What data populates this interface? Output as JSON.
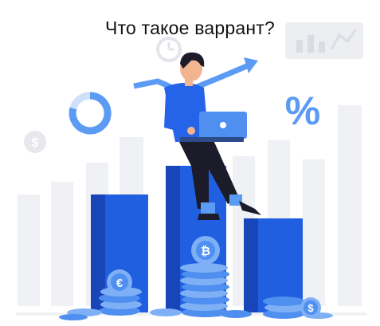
{
  "title": "Что такое варрант?",
  "colors": {
    "background": "#ffffff",
    "accent_blue": "#1f5fe0",
    "dark_blue": "#1845b8",
    "light_blue": "#4f8ff0",
    "faint": "#eef0f3"
  },
  "icons": {
    "dollar_coin": "dollar-coin-icon",
    "percent": "percent-icon",
    "bitcoin": "bitcoin-icon",
    "euro": "euro-coin-icon",
    "clock": "clock-icon",
    "growth_arrow": "growth-arrow-icon"
  },
  "badges": {
    "percent": "%",
    "dollar": "$",
    "bitcoin": "₿",
    "euro": "€"
  }
}
